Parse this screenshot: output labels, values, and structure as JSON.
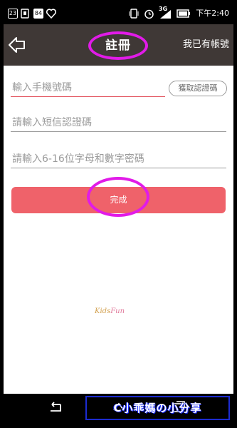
{
  "status_bar": {
    "left_icons": [
      "23",
      "84"
    ],
    "network": "3G",
    "time": "下午2:40"
  },
  "header": {
    "title": "註冊",
    "have_account": "我已有帳號",
    "back_icon": "back-arrow-icon"
  },
  "form": {
    "phone_placeholder": "輸入手機號碼",
    "get_code_label": "獲取認證碼",
    "sms_placeholder": "請輸入短信認證碼",
    "password_placeholder": "請輸入6-16位字母和數字密碼",
    "done_label": "完成"
  },
  "brand": {
    "part1": "Kids",
    "part2": "Fun"
  },
  "watermark": "C小乖媽の小分享",
  "colors": {
    "header_bg": "#3f3836",
    "accent": "#ef626a",
    "highlight_ring": "#e11be8"
  }
}
